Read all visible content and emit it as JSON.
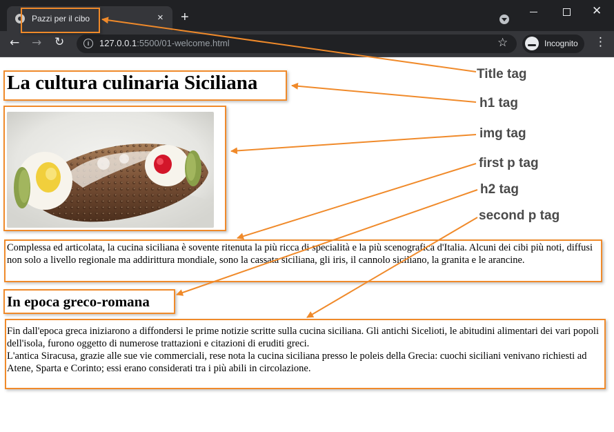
{
  "browser": {
    "tab": {
      "title": "Pazzi per il cibo",
      "close": "×"
    },
    "new_tab": "+",
    "url": {
      "host": "127.0.0.1",
      "path": ":5500/01-welcome.html"
    },
    "incognito_label": "Incognito",
    "icons": {
      "back": "arrow-left-icon",
      "forward": "arrow-right-icon",
      "reload": "reload-icon",
      "info": "info-icon",
      "star": "star-icon",
      "incognito": "incognito-icon",
      "menu": "more-vert-icon",
      "tab_search": "tab-search-icon"
    }
  },
  "page": {
    "h1": "La cultura culinaria Siciliana",
    "image_alt": "cannolo siciliano",
    "p1": "Complessa ed articolata, la cucina siciliana è sovente ritenuta la più ricca di specialità e la più scenografica d'Italia. Alcuni dei cibi più noti, diffusi non solo a livello regionale ma addirittura mondiale, sono la cassata siciliana, gli iris, il cannolo siciliano, la granita e le arancine.",
    "h2": "In epoca greco-romana",
    "p2_line1": "Fin dall'epoca greca iniziarono a diffondersi le prime notizie scritte sulla cucina siciliana. Gli antichi Sicelioti, le abitudini alimentari dei vari popoli dell'isola, furono oggetto di numerose trattazioni e citazioni di eruditi greci.",
    "p2_line2": "L'antica Siracusa, grazie alle sue vie commerciali, rese nota la cucina siciliana presso le poleis della Grecia: cuochi siciliani venivano richiesti ad Atene, Sparta e Corinto; essi erano considerati tra i più abili in circolazione."
  },
  "annotations": {
    "title": "Title tag",
    "h1": "h1 tag",
    "img": "img tag",
    "p1": "first p tag",
    "h2": "h2 tag",
    "p2": "second p tag",
    "color": "#f08a2a",
    "label_color": "#4a4a4a"
  }
}
